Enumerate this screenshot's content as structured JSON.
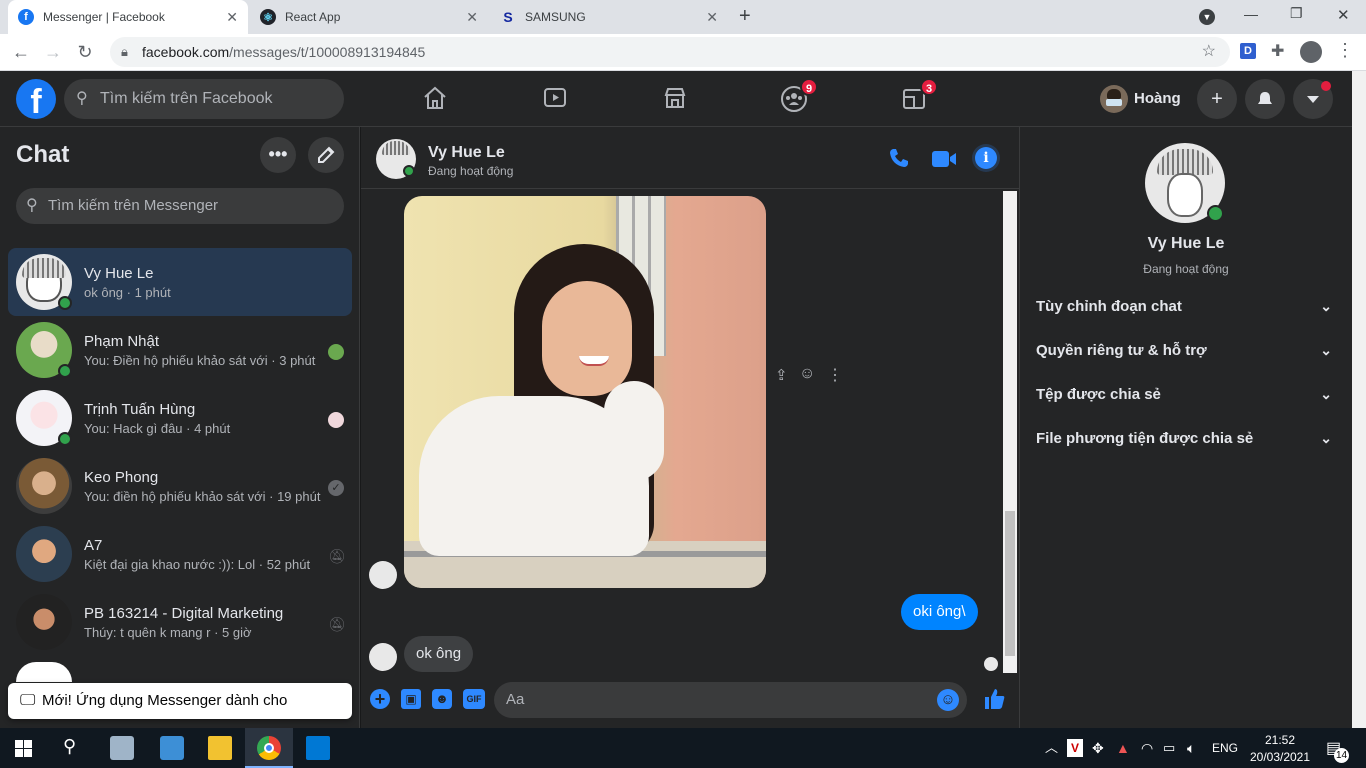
{
  "browser": {
    "tabs": [
      {
        "title": "Messenger | Facebook",
        "favicon": "facebook-icon"
      },
      {
        "title": "React App",
        "favicon": "react-icon"
      },
      {
        "title": "SAMSUNG",
        "favicon": "samsung-icon"
      }
    ],
    "url_host": "facebook.com",
    "url_path": "/messages/t/100008913194845"
  },
  "fb": {
    "search_placeholder": "Tìm kiếm trên Facebook",
    "groups_badge": "9",
    "gaming_badge": "3",
    "user_name": "Hoàng"
  },
  "sidebar": {
    "title": "Chat",
    "search_placeholder": "Tìm kiếm trên Messenger",
    "conversations": [
      {
        "name": "Vy Hue Le",
        "preview": "ok ông · 1 phút"
      },
      {
        "name": "Phạm Nhật",
        "preview": "You: Điền hộ phiếu khảo sát với · 3 phút"
      },
      {
        "name": "Trịnh Tuấn Hùng",
        "preview": "You: Hack gì đâu · 4 phút"
      },
      {
        "name": "Keo Phong",
        "preview": "You: điền hộ phiếu khảo sát với · 19 phút"
      },
      {
        "name": "A7",
        "preview": "Kiệt đại gia khao nước :)): Lol · 52 phút"
      },
      {
        "name": "PB 163214 - Digital Marketing",
        "preview": "Thúy: t quên k mang r · 5 giờ"
      }
    ],
    "toast": "Mới! Ứng dụng Messenger dành cho Windows"
  },
  "chat": {
    "contact_name": "Vy Hue Le",
    "contact_status": "Đang hoạt động",
    "messages": [
      {
        "from": "me",
        "text": "oki ông\\"
      },
      {
        "from": "them",
        "text": "ok ông"
      }
    ],
    "composer_placeholder": "Aa"
  },
  "info": {
    "name": "Vy Hue Le",
    "status": "Đang hoạt động",
    "sections": [
      "Tùy chỉnh đoạn chat",
      "Quyền riêng tư & hỗ trợ",
      "Tệp được chia sẻ",
      "File phương tiện được chia sẻ"
    ]
  },
  "taskbar": {
    "lang": "ENG",
    "time": "21:52",
    "date": "20/03/2021",
    "notif_count": "14"
  },
  "colors": {
    "accent": "#1877f2",
    "fb_bg": "#242526",
    "online": "#31a24c"
  }
}
